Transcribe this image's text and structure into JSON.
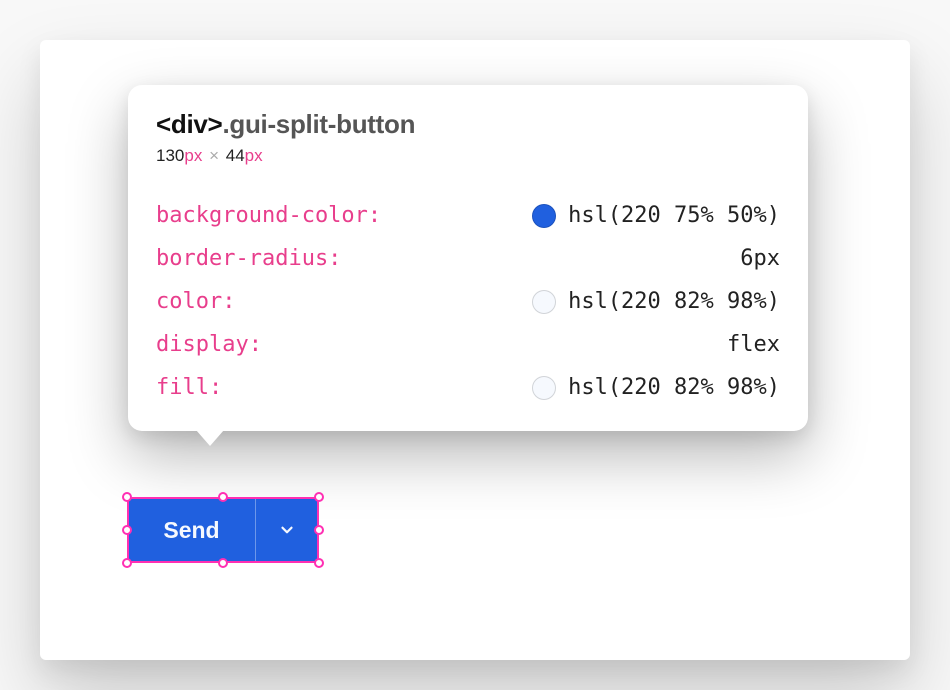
{
  "tooltip": {
    "selector_tag": "<div>",
    "selector_class": ".gui-split-button",
    "dimensions": {
      "width_number": "130",
      "width_unit": "px",
      "sep": "×",
      "height_number": "44",
      "height_unit": "px"
    },
    "props": [
      {
        "name": "background-color:",
        "value": "hsl(220 75% 50%)",
        "swatch": "hsl(220 75% 50%)"
      },
      {
        "name": "border-radius:",
        "value": "6px"
      },
      {
        "name": "color:",
        "value": "hsl(220 82% 98%)",
        "swatch": "hsl(220 82% 98%)"
      },
      {
        "name": "display:",
        "value": "flex"
      },
      {
        "name": "fill:",
        "value": "hsl(220 82% 98%)",
        "swatch": "hsl(220 82% 98%)"
      }
    ]
  },
  "button": {
    "primary_label": "Send"
  },
  "colors": {
    "selection_pink": "#ff2fb3",
    "button_bg": "hsl(220 75% 50%)",
    "button_fg": "hsl(220 82% 98%)"
  }
}
